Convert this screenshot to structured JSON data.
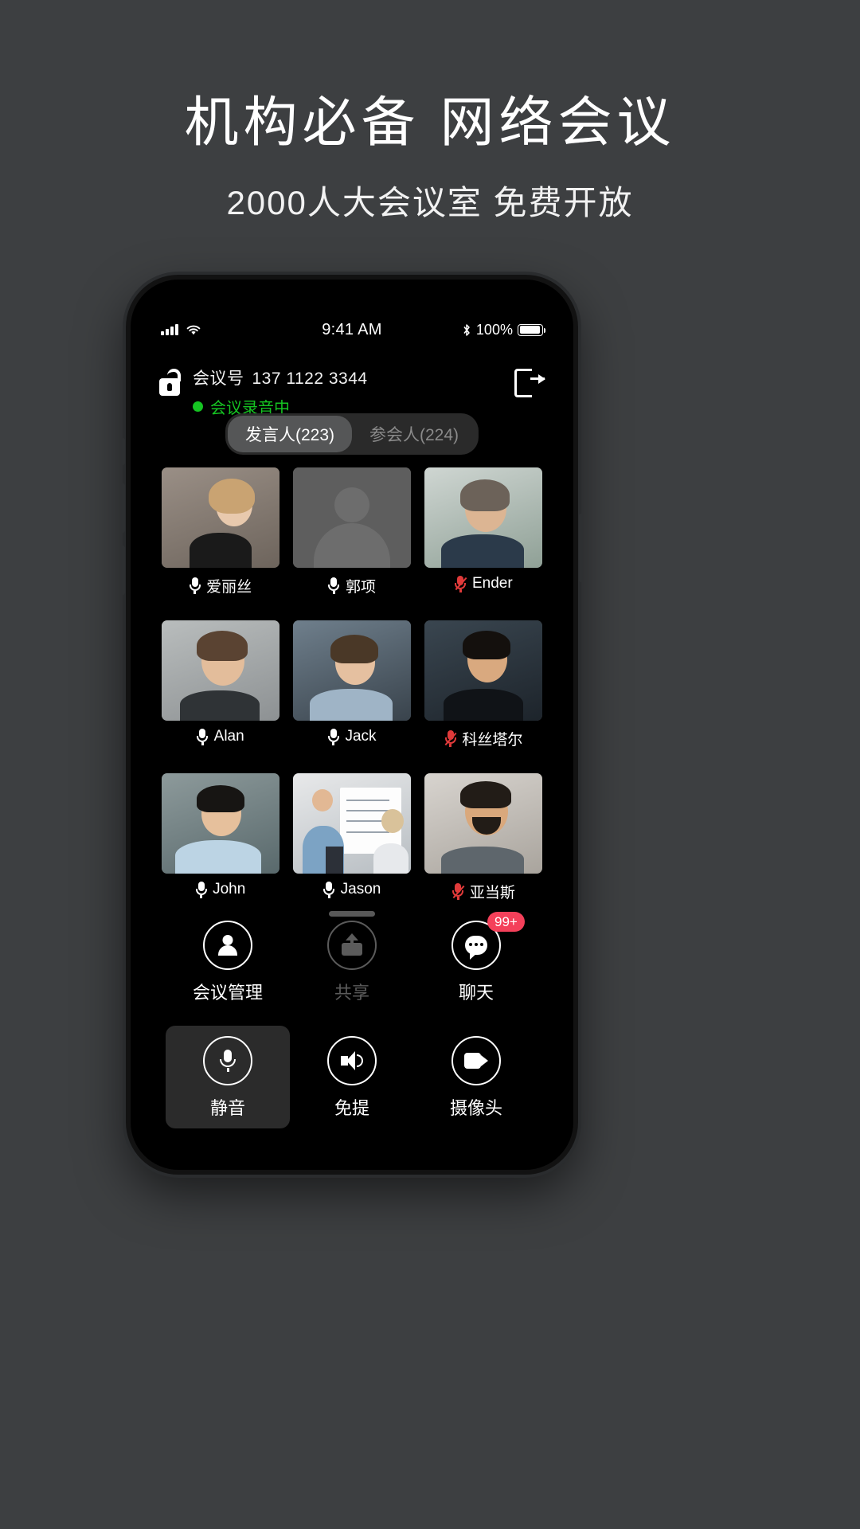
{
  "promo": {
    "title": "机构必备 网络会议",
    "subtitle": "2000人大会议室 免费开放"
  },
  "statusbar": {
    "time": "9:41 AM",
    "battery_percent": "100%",
    "signal_icon": "cellular-bars-icon",
    "wifi_icon": "wifi-icon",
    "bluetooth_icon": "bluetooth-icon",
    "battery_icon": "battery-icon"
  },
  "meeting": {
    "lock_icon": "unlocked-padlock-icon",
    "number_label": "会议号",
    "number": "137 1122 3344",
    "recording_text": "会议录音中",
    "recording_color": "#15c422",
    "leave_icon": "leave-meeting-icon"
  },
  "tabs": [
    {
      "label": "发言人(223)",
      "active": true
    },
    {
      "label": "参会人(224)",
      "active": false
    }
  ],
  "participants": [
    {
      "name": "爱丽丝",
      "muted": false,
      "avatar": "woman-blonde-portrait"
    },
    {
      "name": "郭项",
      "muted": false,
      "avatar": "default-silhouette"
    },
    {
      "name": "Ender",
      "muted": true,
      "avatar": "man-beard-office"
    },
    {
      "name": "Alan",
      "muted": false,
      "avatar": "man-glasses-gray"
    },
    {
      "name": "Jack",
      "muted": false,
      "avatar": "man-glasses-smiling"
    },
    {
      "name": "科丝塔尔",
      "muted": true,
      "avatar": "man-darkhair-suit"
    },
    {
      "name": "John",
      "muted": false,
      "avatar": "man-asian-shirt"
    },
    {
      "name": "Jason",
      "muted": false,
      "avatar": "whiteboard-presentation"
    },
    {
      "name": "亚当斯",
      "muted": true,
      "avatar": "man-beard-smiling"
    }
  ],
  "controls": [
    {
      "label": "会议管理",
      "icon": "meeting-management-icon",
      "state": "normal",
      "badge": null
    },
    {
      "label": "共享",
      "icon": "share-icon",
      "state": "disabled",
      "badge": null
    },
    {
      "label": "聊天",
      "icon": "chat-bubble-icon",
      "state": "normal",
      "badge": "99+"
    },
    {
      "label": "静音",
      "icon": "microphone-icon",
      "state": "active",
      "badge": null
    },
    {
      "label": "免提",
      "icon": "speaker-icon",
      "state": "normal",
      "badge": null
    },
    {
      "label": "摄像头",
      "icon": "camera-icon",
      "state": "normal",
      "badge": null
    }
  ],
  "colors": {
    "page_bg": "#3d3f41",
    "screen_bg": "#000000",
    "accent_record": "#15c422",
    "badge_bg": "#f4405a",
    "muted_mic": "#e03a3a",
    "tab_active_bg": "#555657"
  }
}
